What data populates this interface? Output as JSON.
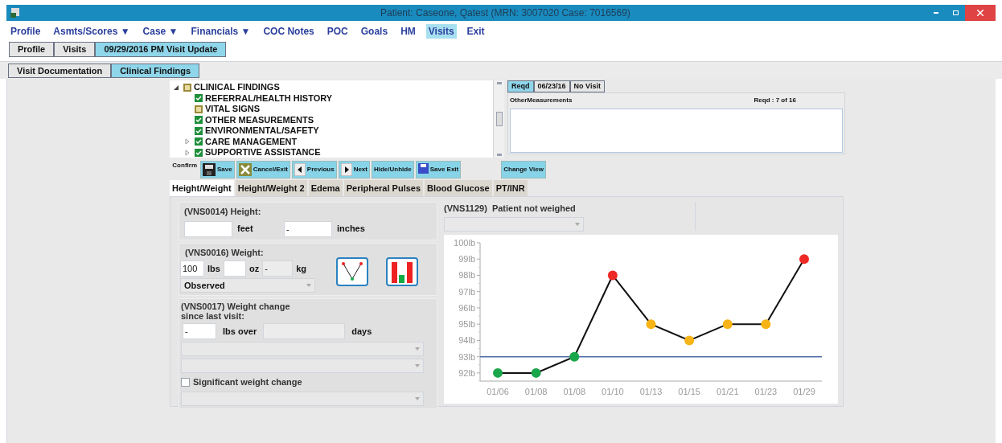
{
  "window": {
    "title": "Patient: Caseone, Qatest (MRN: 3007020 Case: 7016569)"
  },
  "menu": [
    {
      "label": "Profile",
      "selected": false
    },
    {
      "label": "Asmts/Scores ▼",
      "selected": false
    },
    {
      "label": "Case ▼",
      "selected": false
    },
    {
      "label": "Financials ▼",
      "selected": false
    },
    {
      "label": "COC Notes",
      "selected": false
    },
    {
      "label": "POC",
      "selected": false
    },
    {
      "label": "Goals",
      "selected": false
    },
    {
      "label": "HM",
      "selected": false
    },
    {
      "label": "Visits",
      "selected": true
    },
    {
      "label": "Exit",
      "selected": false
    }
  ],
  "tabs": [
    {
      "label": "Profile",
      "selected": false
    },
    {
      "label": "Visits",
      "selected": false
    },
    {
      "label": "09/29/2016 PM Visit Update",
      "selected": true
    }
  ],
  "subtabs": [
    {
      "label": "Visit Documentation",
      "selected": false
    },
    {
      "label": "Clinical Findings",
      "selected": true
    }
  ],
  "tree": [
    {
      "label": "CLINICAL FINDINGS",
      "kind": "partial",
      "expanded": true,
      "children": [
        {
          "label": "REFERRAL/HEALTH HISTORY",
          "kind": "complete"
        },
        {
          "label": "VITAL SIGNS",
          "kind": "partial"
        },
        {
          "label": "OTHER MEASUREMENTS",
          "kind": "complete"
        },
        {
          "label": "ENVIRONMENTAL/SAFETY",
          "kind": "complete"
        },
        {
          "label": "CARE MANAGEMENT",
          "kind": "complete",
          "expanded": false
        },
        {
          "label": "SUPPORTIVE ASSISTANCE",
          "kind": "complete",
          "expanded": false
        }
      ]
    }
  ],
  "side_tabs": [
    {
      "label": "Reqd",
      "selected": true
    },
    {
      "label": "06/23/16",
      "selected": false
    },
    {
      "label": "No Visit",
      "selected": false
    }
  ],
  "side_panel": {
    "title": "OtherMeasurements",
    "count": "Reqd : 7 of 16"
  },
  "toolbar": [
    {
      "kind": "label",
      "label": "Confirm"
    },
    {
      "kind": "button",
      "label": "Save"
    },
    {
      "kind": "button",
      "label": "Cancel/Exit"
    },
    {
      "kind": "button",
      "label": "Previous"
    },
    {
      "kind": "button",
      "label": "Next"
    },
    {
      "kind": "button",
      "label": "Hide/Unhide"
    },
    {
      "kind": "button",
      "label": "Save Exit"
    },
    {
      "kind": "spacer"
    },
    {
      "kind": "button",
      "label": "Change View"
    }
  ],
  "form_tabs": [
    {
      "label": "Height/Weight",
      "selected": true
    },
    {
      "label": "Height/Weight 2",
      "selected": false
    },
    {
      "label": "Edema",
      "selected": false
    },
    {
      "label": "Peripheral Pulses",
      "selected": false
    },
    {
      "label": "Blood Glucose",
      "selected": false
    },
    {
      "label": "PT/INR",
      "selected": false
    }
  ],
  "height": {
    "title": "(VNS0014) Height:",
    "feet_unit": "feet",
    "inches_value": "-",
    "inches_unit": "inches"
  },
  "weight": {
    "title": "(VNS0016) Weight:",
    "lbs_value": "100",
    "lbs_unit": "lbs",
    "oz_unit": "oz",
    "kg_value": "-",
    "kg_unit": "kg",
    "method": "Observed"
  },
  "weight_change": {
    "title": "(VNS0017) Weight change",
    "title_2": "since last visit:",
    "lbs_value": "-",
    "lbs_unit": "lbs over",
    "days_unit": "days",
    "significant_label": "Significant weight change",
    "significant_checked": false
  },
  "not_weighed": {
    "title": "(VNS1129)  Patient not weighed"
  },
  "weight_chart": {
    "points": [
      {
        "color": "#1aa64a"
      },
      {
        "color": "#1aa64a"
      },
      {
        "color": "#1aa64a"
      },
      {
        "color": "#ee2a24"
      },
      {
        "color": "#f7b417"
      },
      {
        "color": "#f7b417"
      },
      {
        "color": "#f7b417"
      },
      {
        "color": "#f7b417"
      },
      {
        "color": "#ee2a24"
      }
    ],
    "chart_data": {
      "type": "line",
      "categories": [
        "01/06",
        "01/08",
        "01/08",
        "01/10",
        "01/13",
        "01/15",
        "01/21",
        "01/23",
        "01/29"
      ],
      "series": [
        {
          "color": "#111111",
          "marker": "circle",
          "values": [
            92,
            92,
            93,
            98,
            95,
            94,
            95,
            95,
            99
          ]
        }
      ],
      "ylim": [
        91.5,
        100
      ],
      "yticks": [
        {
          "value": 92,
          "label": "92lb"
        },
        {
          "value": 93,
          "label": "93lb"
        },
        {
          "value": 94,
          "label": "94lb"
        },
        {
          "value": 95,
          "label": "95lb"
        },
        {
          "value": 96,
          "label": "96lb"
        },
        {
          "value": 97,
          "label": "97lb"
        },
        {
          "value": 98,
          "label": "98lb"
        },
        {
          "value": 99,
          "label": "99lb"
        },
        {
          "value": 100,
          "label": "100lb"
        }
      ],
      "ref_lines": [
        {
          "axis": "y",
          "value": 93,
          "color": "#4a6da7"
        }
      ]
    }
  }
}
